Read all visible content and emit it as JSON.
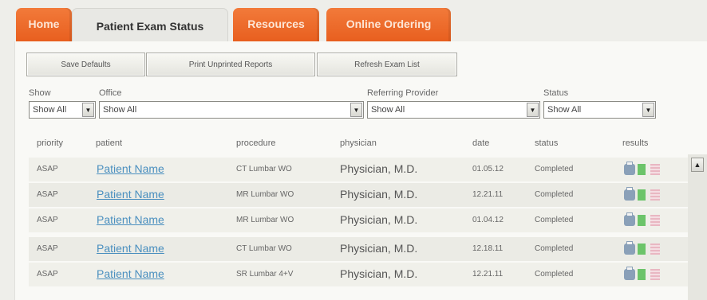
{
  "tabs": {
    "home": "Home",
    "patient_exam_status": "Patient Exam Status",
    "resources": "Resources",
    "online_ordering": "Online Ordering"
  },
  "toolbar": {
    "save_defaults": "Save Defaults",
    "print_unprinted": "Print Unprinted Reports",
    "refresh_exam_list": "Refresh Exam List"
  },
  "filters": {
    "show": {
      "label": "Show",
      "value": "Show All"
    },
    "office": {
      "label": "Office",
      "value": "Show All"
    },
    "referring_provider": {
      "label": "Referring Provider",
      "value": "Show All"
    },
    "status": {
      "label": "Status",
      "value": "Show All"
    }
  },
  "table": {
    "headers": {
      "priority": "priority",
      "patient": "patient",
      "procedure": "procedure",
      "physician": "physician",
      "date": "date",
      "status": "status",
      "results": "results"
    },
    "rows": [
      {
        "priority": "ASAP",
        "patient": "Patient Name",
        "procedure": "CT Lumbar WO",
        "physician": "Physician, M.D.",
        "date": "01.05.12",
        "status": "Completed"
      },
      {
        "priority": "ASAP",
        "patient": "Patient Name",
        "procedure": "MR Lumbar WO",
        "physician": "Physician, M.D.",
        "date": "12.21.11",
        "status": "Completed"
      },
      {
        "priority": "ASAP",
        "patient": "Patient Name",
        "procedure": "MR Lumbar WO",
        "physician": "Physician, M.D.",
        "date": "01.04.12",
        "status": "Completed"
      },
      {
        "priority": "ASAP",
        "patient": "Patient Name",
        "procedure": "CT Lumbar WO",
        "physician": "Physician, M.D.",
        "date": "12.18.11",
        "status": "Completed"
      },
      {
        "priority": "ASAP",
        "patient": "Patient Name",
        "procedure": "SR Lumbar 4+V",
        "physician": "Physician, M.D.",
        "date": "12.21.11",
        "status": "Completed"
      }
    ]
  },
  "icons": {
    "print": "printer-icon",
    "report": "document-icon",
    "images": "image-icon",
    "scroll_up": "▲"
  },
  "colors": {
    "tab_orange": "#e8651f",
    "link_blue": "#4a8fbf"
  }
}
